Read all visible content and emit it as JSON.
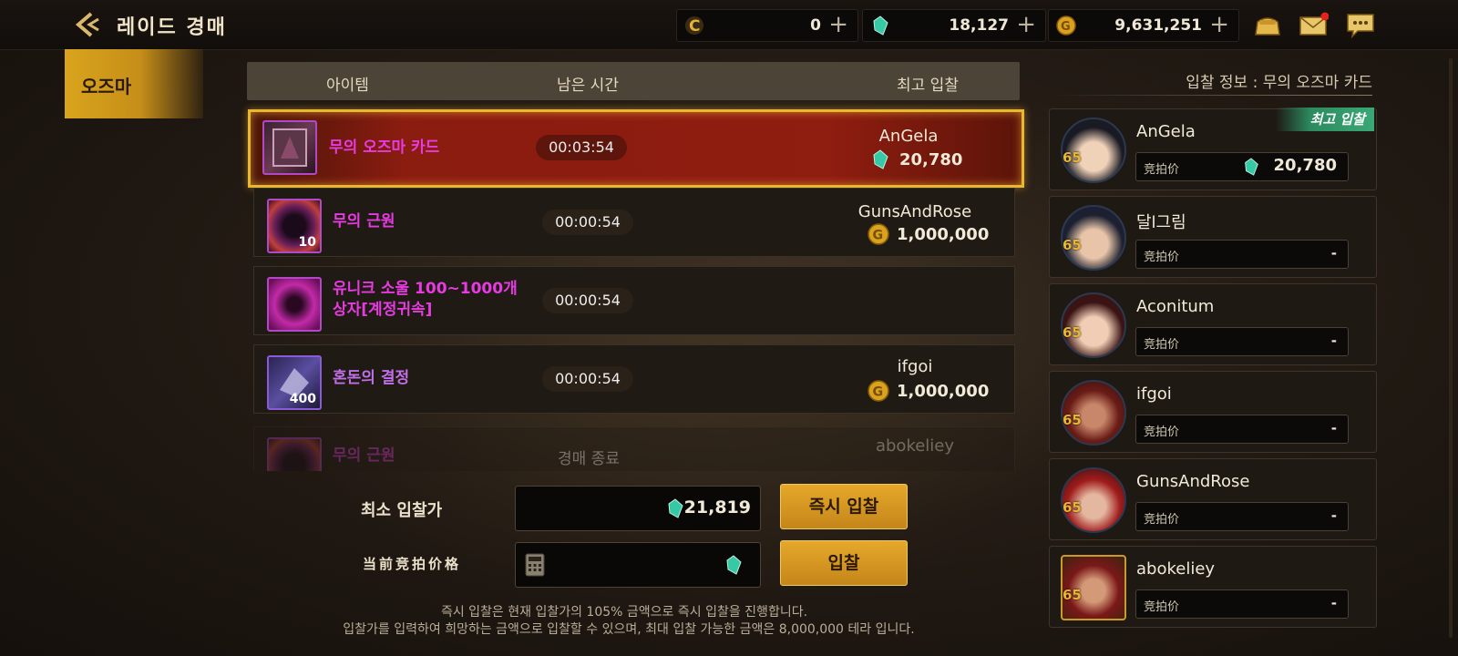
{
  "header": {
    "title": "레이드 경매",
    "currencies": [
      {
        "icon": "coin-c-icon",
        "value": "0"
      },
      {
        "icon": "tera-gem-icon",
        "value": "18,127"
      },
      {
        "icon": "gold-coin-icon",
        "value": "9,631,251"
      }
    ],
    "icons": [
      "pouch-icon",
      "mail-icon",
      "chat-icon"
    ]
  },
  "category": {
    "label": "오즈마"
  },
  "table": {
    "headers": [
      "아이템",
      "남은 시간",
      "최고 입찰"
    ],
    "rows": [
      {
        "name": "무의 오즈마 카드",
        "time": "00:03:54",
        "bidder": "AnGela",
        "amount": "20,780",
        "currency": "gem",
        "count": ""
      },
      {
        "name": "무의 근원",
        "time": "00:00:54",
        "bidder": "GunsAndRose",
        "amount": "1,000,000",
        "currency": "gold",
        "count": "10"
      },
      {
        "name_line1": "유니크 소울 100~1000개",
        "name_line2": "상자[계정귀속]",
        "time": "00:00:54",
        "bidder": "",
        "amount": "",
        "currency": "",
        "count": ""
      },
      {
        "name": "혼돈의 결정",
        "time": "00:00:54",
        "bidder": "ifgoi",
        "amount": "1,000,000",
        "currency": "gold",
        "count": "400"
      },
      {
        "name": "무의 근원",
        "time": "경매 종료",
        "bidder": "abokeliey",
        "amount": "",
        "currency": "gold",
        "count": ""
      }
    ]
  },
  "bid": {
    "min_label": "최소 입찰가",
    "min_value": "21,819",
    "current_label": "当前竞拍价格",
    "instant_button": "즉시 입찰",
    "bid_button": "입찰",
    "note1": "즉시 입찰은 현재 입찰가의 105% 금액으로 즉시 입찰을 진행합니다.",
    "note2": "입찰가를 입력하여 희망하는 금액으로 입찰할 수 있으며, 최대 입찰 가능한 금액은 8,000,000 테라 입니다."
  },
  "bidinfo": {
    "title": "입찰 정보 : 무의 오즈마 카드",
    "badge": "최고 입찰",
    "bid_label": "竞拍价",
    "bidders": [
      {
        "name": "AnGela",
        "level": "65",
        "value": "20,780"
      },
      {
        "name": "달l그림",
        "level": "65",
        "value": "-"
      },
      {
        "name": "Aconitum",
        "level": "65",
        "value": "-"
      },
      {
        "name": "ifgoi",
        "level": "65",
        "value": "-"
      },
      {
        "name": "GunsAndRose",
        "level": "65",
        "value": "-"
      },
      {
        "name": "abokeliey",
        "level": "65",
        "value": "-"
      }
    ]
  },
  "colors": {
    "accent_gold": "#d9a41d",
    "item_magenta": "#e63be0",
    "selected_row": "#8b1c10"
  }
}
